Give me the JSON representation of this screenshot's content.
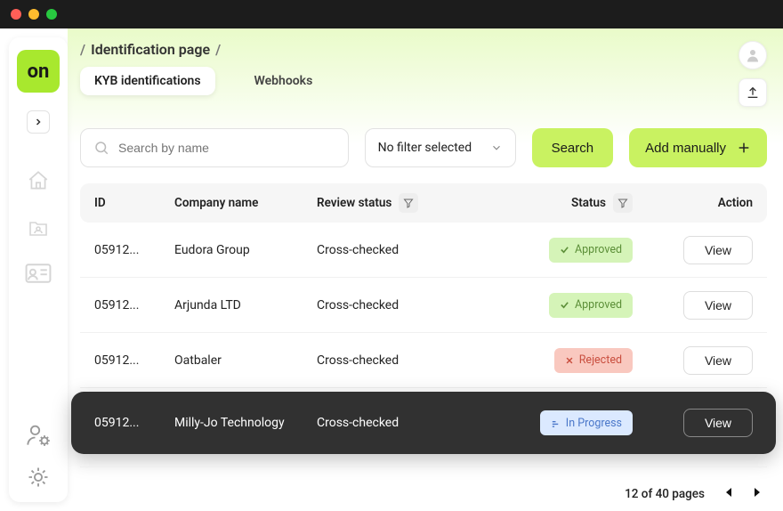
{
  "logoText": "on",
  "breadcrumb": "Identification page",
  "tabs": {
    "kyb": "KYB identifications",
    "webhooks": "Webhooks"
  },
  "search": {
    "placeholder": "Search by name"
  },
  "filterSelect": "No filter selected",
  "buttons": {
    "search": "Search",
    "addManually": "Add manually",
    "view": "View"
  },
  "columns": {
    "id": "ID",
    "company": "Company name",
    "review": "Review status",
    "status": "Status",
    "action": "Action"
  },
  "statusLabels": {
    "approved": "Approved",
    "rejected": "Rejected",
    "inProgress": "In Progress"
  },
  "rows": [
    {
      "id": "05912...",
      "company": "Eudora Group",
      "review": "Cross-checked",
      "status": "approved"
    },
    {
      "id": "05912...",
      "company": "Arjunda LTD",
      "review": "Cross-checked",
      "status": "approved"
    },
    {
      "id": "05912...",
      "company": "Oatbaler",
      "review": "Cross-checked",
      "status": "rejected"
    },
    {
      "id": "05912...",
      "company": "Milly-Jo Technology",
      "review": "Cross-checked",
      "status": "inProgress"
    }
  ],
  "pagination": "12 of 40 pages"
}
